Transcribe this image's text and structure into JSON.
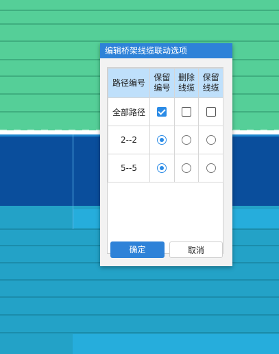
{
  "dialog": {
    "title": "编辑桥架线缆联动选项",
    "columns": [
      "路径编号",
      "保留\n编号",
      "删除\n线缆",
      "保留\n线缆"
    ],
    "rows": [
      {
        "name": "全部路径",
        "type": "checkbox",
        "checked": [
          true,
          false,
          false
        ]
      },
      {
        "name": "2--2",
        "type": "radio",
        "selected": 0
      },
      {
        "name": "5--5",
        "type": "radio",
        "selected": 0
      }
    ],
    "ok_label": "确定",
    "cancel_label": "取消"
  },
  "colors": {
    "accent": "#2e82d8",
    "background_green": "#55cf98",
    "background_navy": "#0a4e9c",
    "background_teal": "#23a2c7"
  }
}
